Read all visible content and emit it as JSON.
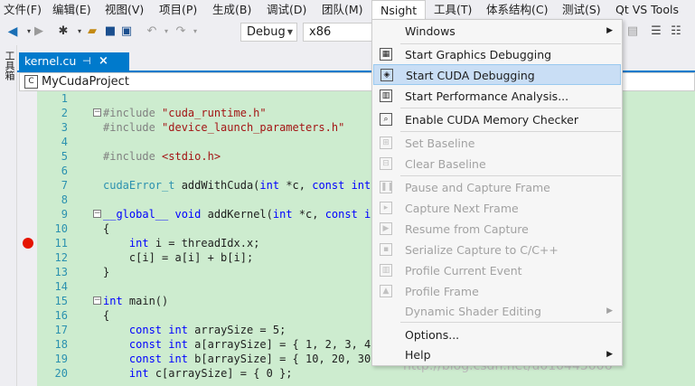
{
  "menubar": {
    "items": [
      "文件(F)",
      "编辑(E)",
      "视图(V)",
      "项目(P)",
      "生成(B)",
      "调试(D)",
      "团队(M)",
      "Nsight",
      "工具(T)",
      "体系结构(C)",
      "测试(S)",
      "Qt VS Tools"
    ]
  },
  "toolbar": {
    "config": "Debug",
    "platform": "x86"
  },
  "left_tool_window": "工具箱",
  "tab": {
    "label": "kernel.cu",
    "pin": "⊣",
    "close": "×"
  },
  "navbar": {
    "project": "MyCudaProject"
  },
  "editor": {
    "breakpoint_line": "11",
    "lines": [
      {
        "n": "1",
        "t": ""
      },
      {
        "n": "2",
        "t": "#include \"cuda_runtime.h\""
      },
      {
        "n": "3",
        "t": "#include \"device_launch_parameters.h\""
      },
      {
        "n": "4",
        "t": ""
      },
      {
        "n": "5",
        "t": "#include <stdio.h>"
      },
      {
        "n": "6",
        "t": ""
      },
      {
        "n": "7",
        "t": "cudaError_t addWithCuda(int *c, const int *"
      },
      {
        "n": "8",
        "t": ""
      },
      {
        "n": "9",
        "t": "__global__ void addKernel(int *c, const int"
      },
      {
        "n": "10",
        "t": "{"
      },
      {
        "n": "11",
        "t": "    int i = threadIdx.x;"
      },
      {
        "n": "12",
        "t": "    c[i] = a[i] + b[i];"
      },
      {
        "n": "13",
        "t": "}"
      },
      {
        "n": "14",
        "t": ""
      },
      {
        "n": "15",
        "t": "int main()"
      },
      {
        "n": "16",
        "t": "{"
      },
      {
        "n": "17",
        "t": "    const int arraySize = 5;"
      },
      {
        "n": "18",
        "t": "    const int a[arraySize] = { 1, 2, 3, 4,"
      },
      {
        "n": "19",
        "t": "    const int b[arraySize] = { 10, 20, 30,"
      },
      {
        "n": "20",
        "t": "    int c[arraySize] = { 0 };"
      }
    ]
  },
  "nsight_menu": {
    "windows": "Windows",
    "start_graphics_debugging": "Start Graphics Debugging",
    "start_cuda_debugging": "Start CUDA Debugging",
    "start_performance_analysis": "Start Performance Analysis...",
    "enable_cuda_memory_checker": "Enable CUDA Memory Checker",
    "set_baseline": "Set Baseline",
    "clear_baseline": "Clear Baseline",
    "pause_and_capture_frame": "Pause and Capture Frame",
    "capture_next_frame": "Capture Next Frame",
    "resume_from_capture": "Resume from Capture",
    "serialize_capture": "Serialize Capture to C/C++",
    "profile_current_event": "Profile Current Event",
    "profile_frame": "Profile Frame",
    "dynamic_shader_editing": "Dynamic Shader Editing",
    "options": "Options...",
    "help": "Help"
  },
  "watermark": "http://blog.csdn.net/u010445006",
  "colors": {
    "accent": "#007acc",
    "editor_bg": "#cdeccf",
    "breakpoint": "#e51400",
    "menu_hover": "#c9def5"
  }
}
